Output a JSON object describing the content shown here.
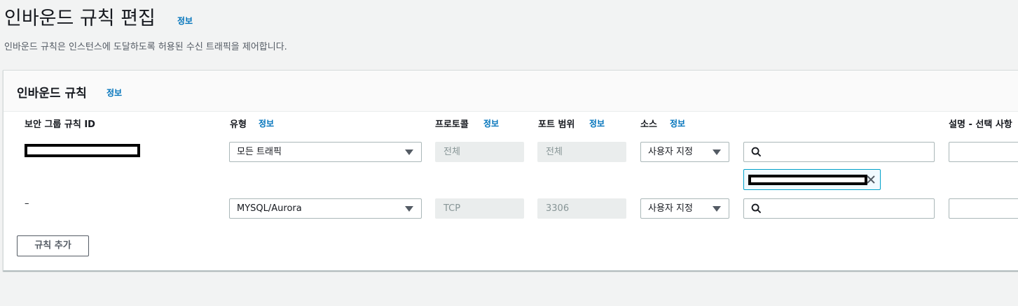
{
  "page": {
    "title": "인바운드 규칙 편집",
    "title_info": "정보",
    "description": "인바운드 규칙은 인스턴스에 도달하도록 허용된 수신 트래픽을 제어합니다."
  },
  "panel": {
    "title": "인바운드 규칙",
    "info": "정보",
    "columns": {
      "rule_id": "보안 그룹 규칙 ID",
      "type": "유형",
      "type_info": "정보",
      "protocol": "프로토콜",
      "protocol_info": "정보",
      "port_range": "포트 범위",
      "port_range_info": "정보",
      "source": "소스",
      "source_info": "정보",
      "description": "설명 - 선택 사항"
    },
    "rules": [
      {
        "rule_id": "",
        "type": "모든 트래픽",
        "protocol": "전체",
        "port_range": "전체",
        "source": "사용자 지정"
      },
      {
        "rule_id": "–",
        "type": "MYSQL/Aurora",
        "protocol": "TCP",
        "port_range": "3306",
        "source": "사용자 지정"
      }
    ],
    "add_rule_label": "규칙 추가"
  },
  "icons": {
    "search": "search-icon",
    "close": "close-icon",
    "caret": "caret-down-icon"
  },
  "colors": {
    "link": "#0073bb",
    "token_border": "#00a1c9",
    "background": "#f2f3f3"
  }
}
